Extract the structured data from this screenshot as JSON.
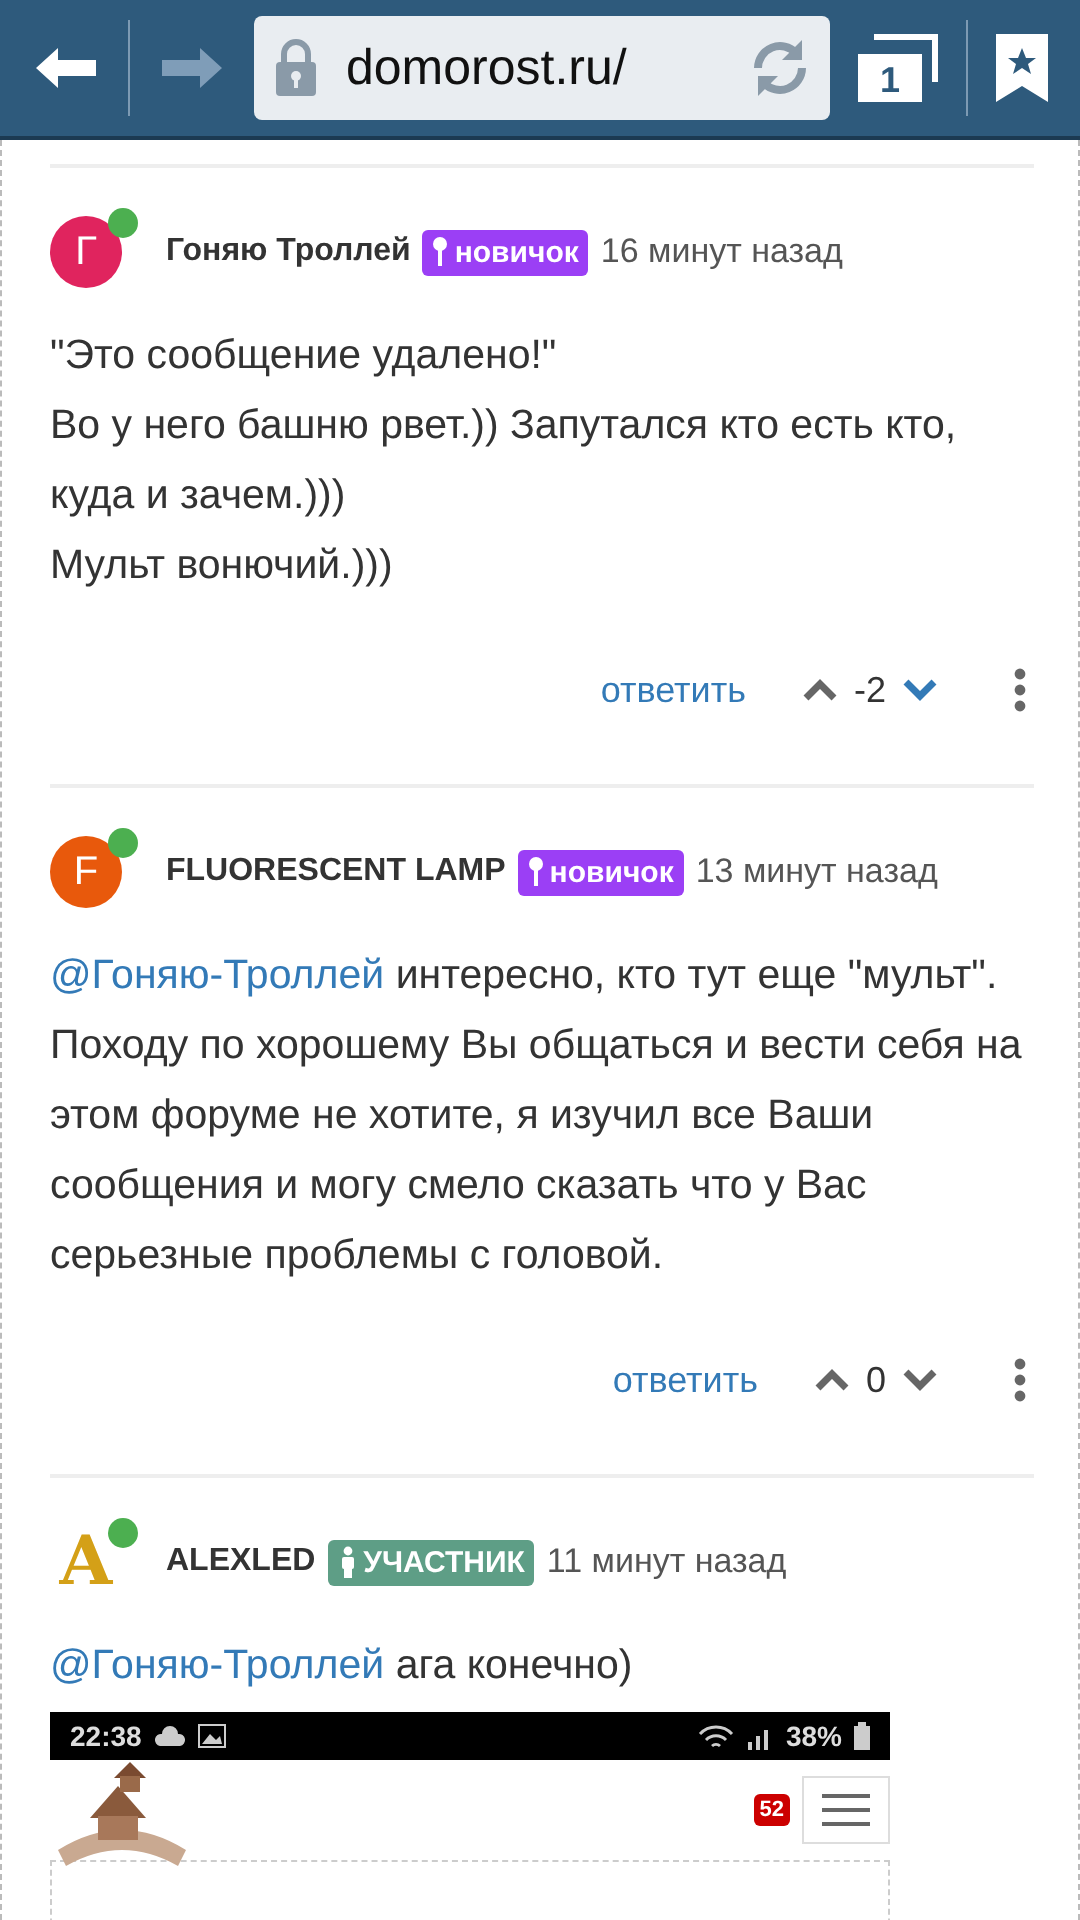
{
  "browser": {
    "url": "domorost.ru/",
    "tab_count": "1"
  },
  "comments": [
    {
      "avatar": {
        "kind": "letter",
        "letter": "Г",
        "color": "#e0245e"
      },
      "online": true,
      "author": "Гоняю Троллей",
      "badge": {
        "kind": "newbie",
        "label": "новичок",
        "color": "#9b3ff5"
      },
      "time": "16 минут назад",
      "paragraphs": [
        {
          "text": "\"Это сообщение удалено!\""
        },
        {
          "text": "Во у него башню рвет.)) Запутался кто есть кто, куда и зачем.)))"
        },
        {
          "text": "Мульт вонючий.)))"
        }
      ],
      "reply": "ответить",
      "score": "-2",
      "downvoted": true
    },
    {
      "avatar": {
        "kind": "letter",
        "letter": "F",
        "color": "#e8590c"
      },
      "online": true,
      "author": "FLUORESCENT LAMP",
      "badge": {
        "kind": "newbie",
        "label": "новичок",
        "color": "#9b3ff5"
      },
      "time": "13 минут назад",
      "paragraphs": [
        {
          "mention": "@Гоняю-Троллей",
          "text": "интересно, кто тут еще \"мульт\". Походу по хорошему Вы общаться и вести себя на этом форуме не хотите, я изучил все Ваши сообщения и могу смело сказать что у Вас серьезные проблемы с головой."
        }
      ],
      "reply": "ответить",
      "score": "0",
      "downvoted": false
    },
    {
      "avatar": {
        "kind": "emblem",
        "letter": "A",
        "color": "#d4a017"
      },
      "online": true,
      "author": "ALEXLED",
      "badge": {
        "kind": "member",
        "label": "УЧАСТНИК",
        "color": "#5e9e86"
      },
      "time": "11 минут назад",
      "paragraphs": [
        {
          "mention": "@Гоняю-Троллей",
          "text": "ага конечно)"
        }
      ],
      "attachment": {
        "time": "22:38",
        "battery": "38%",
        "notifications": "52"
      }
    }
  ]
}
